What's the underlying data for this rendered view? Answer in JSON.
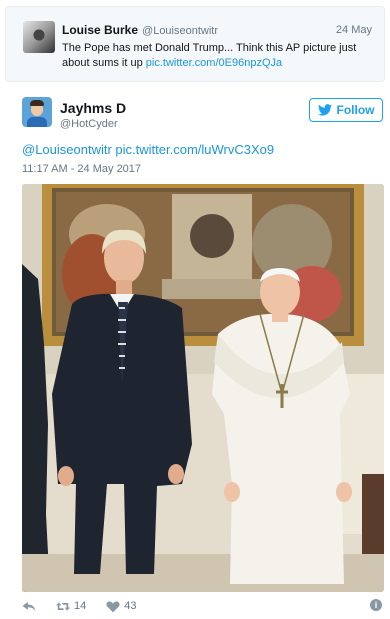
{
  "quoted_tweet": {
    "name": "Louise Burke",
    "handle": "@Louiseontwitr",
    "date": "24 May",
    "text": "The Pope has met Donald Trump... Think this AP picture just about sums it up ",
    "link": "pic.twitter.com/0E96npzQJa"
  },
  "tweet": {
    "name": "Jayhms D",
    "handle": "@HotCyder",
    "follow_label": "Follow",
    "mention": "@Louiseontwitr",
    "link": "pic.twitter.com/luWrvC3Xo9",
    "timestamp": "11:17 AM - 24 May 2017"
  },
  "actions": {
    "retweets": "14",
    "likes": "43",
    "info_label": "i"
  },
  "colors": {
    "accent": "#1da1f2",
    "link": "#1b95e0",
    "muted": "#657786"
  }
}
